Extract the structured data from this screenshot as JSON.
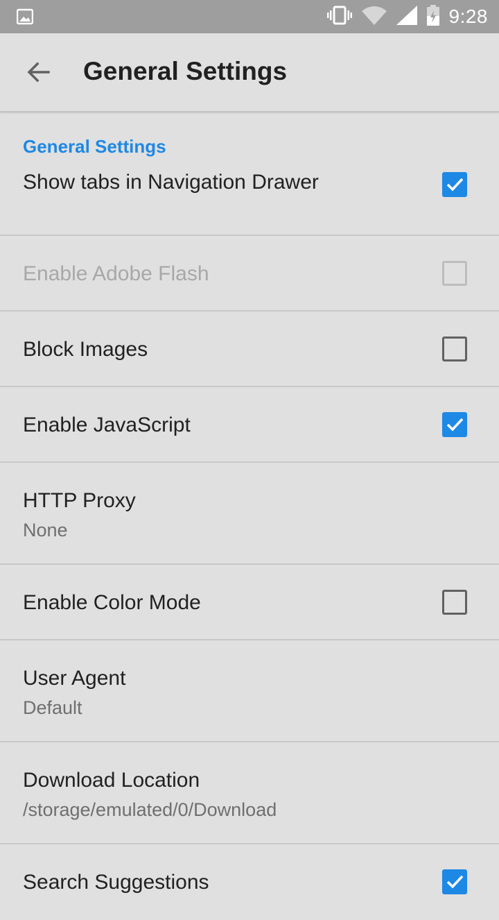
{
  "status_bar": {
    "time": "9:28",
    "icons": [
      "image-icon",
      "vibrate-icon",
      "wifi-icon",
      "signal-icon",
      "battery-icon"
    ]
  },
  "toolbar": {
    "back_icon": "arrow-back-icon",
    "title": "General Settings"
  },
  "section": {
    "header": "General Settings"
  },
  "preferences": [
    {
      "title": "Show tabs in Navigation Drawer",
      "type": "checkbox",
      "checked": true,
      "enabled": true
    },
    {
      "title": "Enable Adobe Flash",
      "type": "checkbox",
      "checked": false,
      "enabled": false
    },
    {
      "title": "Block Images",
      "type": "checkbox",
      "checked": false,
      "enabled": true
    },
    {
      "title": "Enable JavaScript",
      "type": "checkbox",
      "checked": true,
      "enabled": true
    },
    {
      "title": "HTTP Proxy",
      "summary": "None",
      "type": "summary"
    },
    {
      "title": "Enable Color Mode",
      "type": "checkbox",
      "checked": false,
      "enabled": true
    },
    {
      "title": "User Agent",
      "summary": "Default",
      "type": "summary"
    },
    {
      "title": "Download Location",
      "summary": "/storage/emulated/0/Download",
      "type": "summary"
    },
    {
      "title": "Search Suggestions",
      "type": "checkbox",
      "checked": true,
      "enabled": true
    }
  ],
  "colors": {
    "accent": "#1e88e5",
    "background": "#e0e0e0",
    "status_bar": "#9e9e9e"
  }
}
